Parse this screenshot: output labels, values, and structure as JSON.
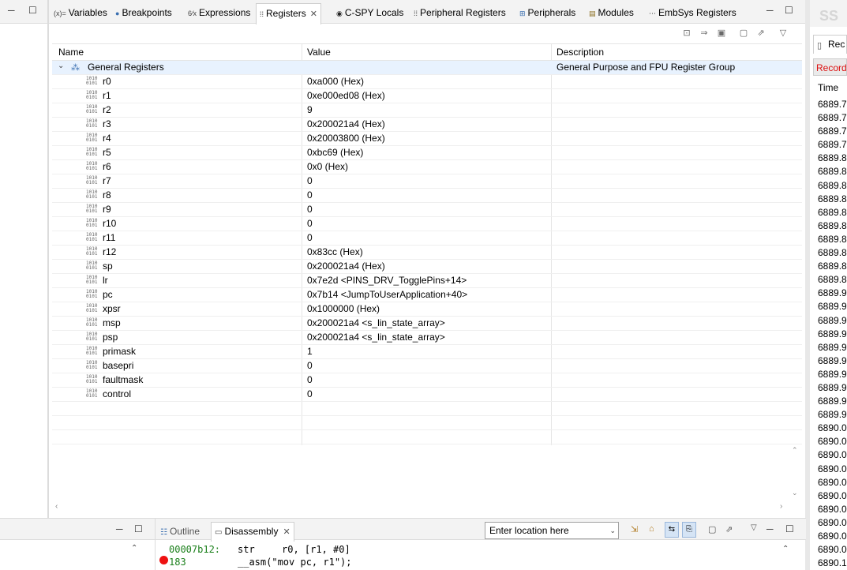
{
  "view": {
    "tabs": [
      {
        "label": "Variables",
        "icon": "(x)="
      },
      {
        "label": "Breakpoints",
        "icon": "breakpoints-icon"
      },
      {
        "label": "Expressions",
        "icon": "expressions-icon"
      },
      {
        "label": "Registers",
        "icon": "registers-icon",
        "active": true
      },
      {
        "label": "C-SPY Locals",
        "icon": "cspy-locals-icon"
      },
      {
        "label": "Peripheral Registers",
        "icon": "peripheral-registers-icon"
      },
      {
        "label": "Peripherals",
        "icon": "peripherals-icon"
      },
      {
        "label": "Modules",
        "icon": "modules-icon"
      },
      {
        "label": "EmbSys Registers",
        "icon": "embsys-icon"
      }
    ],
    "columns": {
      "name": "Name",
      "value": "Value",
      "description": "Description"
    },
    "group": {
      "name": "General Registers",
      "description": "General Purpose and FPU Register Group"
    },
    "registers": [
      {
        "name": "r0",
        "value": "0xa000 (Hex)"
      },
      {
        "name": "r1",
        "value": "0xe000ed08 (Hex)"
      },
      {
        "name": "r2",
        "value": "9"
      },
      {
        "name": "r3",
        "value": "0x200021a4 (Hex)"
      },
      {
        "name": "r4",
        "value": "0x20003800 (Hex)"
      },
      {
        "name": "r5",
        "value": "0xbc69 (Hex)"
      },
      {
        "name": "r6",
        "value": "0x0 (Hex)"
      },
      {
        "name": "r7",
        "value": "0"
      },
      {
        "name": "r8",
        "value": "0"
      },
      {
        "name": "r9",
        "value": "0"
      },
      {
        "name": "r10",
        "value": "0"
      },
      {
        "name": "r11",
        "value": "0"
      },
      {
        "name": "r12",
        "value": "0x83cc (Hex)"
      },
      {
        "name": "sp",
        "value": "0x200021a4 (Hex)"
      },
      {
        "name": "lr",
        "value": "0x7e2d <PINS_DRV_TogglePins+14>"
      },
      {
        "name": "pc",
        "value": "0x7b14 <JumpToUserApplication+40>"
      },
      {
        "name": "xpsr",
        "value": "0x1000000 (Hex)"
      },
      {
        "name": "msp",
        "value": "0x200021a4 <s_lin_state_array>"
      },
      {
        "name": "psp",
        "value": "0x200021a4 <s_lin_state_array>"
      },
      {
        "name": "primask",
        "value": "1"
      },
      {
        "name": "basepri",
        "value": "0"
      },
      {
        "name": "faultmask",
        "value": "0"
      },
      {
        "name": "control",
        "value": "0"
      }
    ]
  },
  "right_panel": {
    "tab_label": "Rec",
    "recording_label": "Recordi",
    "time_header": "Time",
    "times": [
      "6889.7",
      "6889.7",
      "6889.7",
      "6889.7",
      "6889.8",
      "6889.8",
      "6889.8",
      "6889.8",
      "6889.8",
      "6889.8",
      "6889.8",
      "6889.8",
      "6889.8",
      "6889.8",
      "6889.9",
      "6889.9",
      "6889.9",
      "6889.9",
      "6889.9",
      "6889.9",
      "6889.9",
      "6889.9",
      "6889.9",
      "6889.9",
      "6890.0",
      "6890.0",
      "6890.0",
      "6890.0",
      "6890.0",
      "6890.0",
      "6890.0",
      "6890.0",
      "6890.0",
      "6890.0",
      "6890.1"
    ]
  },
  "bottom": {
    "tabs": [
      {
        "label": "Outline",
        "icon": "outline-icon"
      },
      {
        "label": "Disassembly",
        "icon": "disassembly-icon",
        "active": true
      }
    ],
    "location_placeholder": "Enter location here",
    "asm_address": "00007b12:",
    "asm_instr": "str",
    "asm_operands": "r0, [r1, #0]",
    "src_line": "183",
    "src_code": "__asm(\"mov pc, r1\");"
  },
  "colors": {
    "selection": "#e8f2fe",
    "address_green": "#1a7f1a",
    "recording_red": "#dd1111",
    "breakpoint_red": "#ee1111"
  }
}
